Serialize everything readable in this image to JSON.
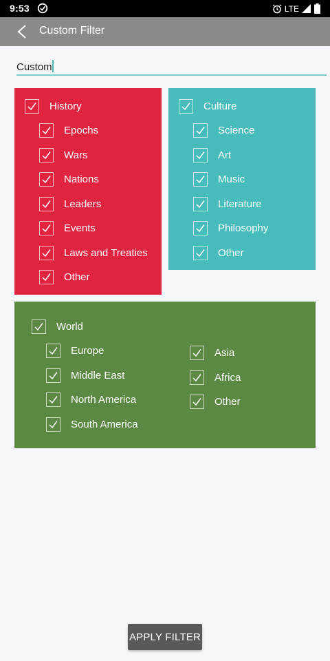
{
  "status_bar": {
    "time": "9:53",
    "network": "LTE"
  },
  "app_bar": {
    "title": "Custom Filter"
  },
  "filter_name": {
    "value": "Custom"
  },
  "history": {
    "label": "History",
    "items": [
      "Epochs",
      "Wars",
      "Nations",
      "Leaders",
      "Events",
      "Laws and Treaties",
      "Other"
    ]
  },
  "culture": {
    "label": "Culture",
    "items": [
      "Science",
      "Art",
      "Music",
      "Literature",
      "Philosophy",
      "Other"
    ]
  },
  "world": {
    "label": "World",
    "left_items": [
      "Europe",
      "Middle East",
      "North America",
      "South America"
    ],
    "right_items": [
      "Asia",
      "Africa",
      "Other"
    ]
  },
  "apply_button": {
    "label": "APPLY FILTER"
  },
  "colors": {
    "history": "#e0233f",
    "culture": "#48bcbc",
    "world": "#5b8842",
    "app_bar": "#8a8a8a",
    "button": "#595959"
  }
}
